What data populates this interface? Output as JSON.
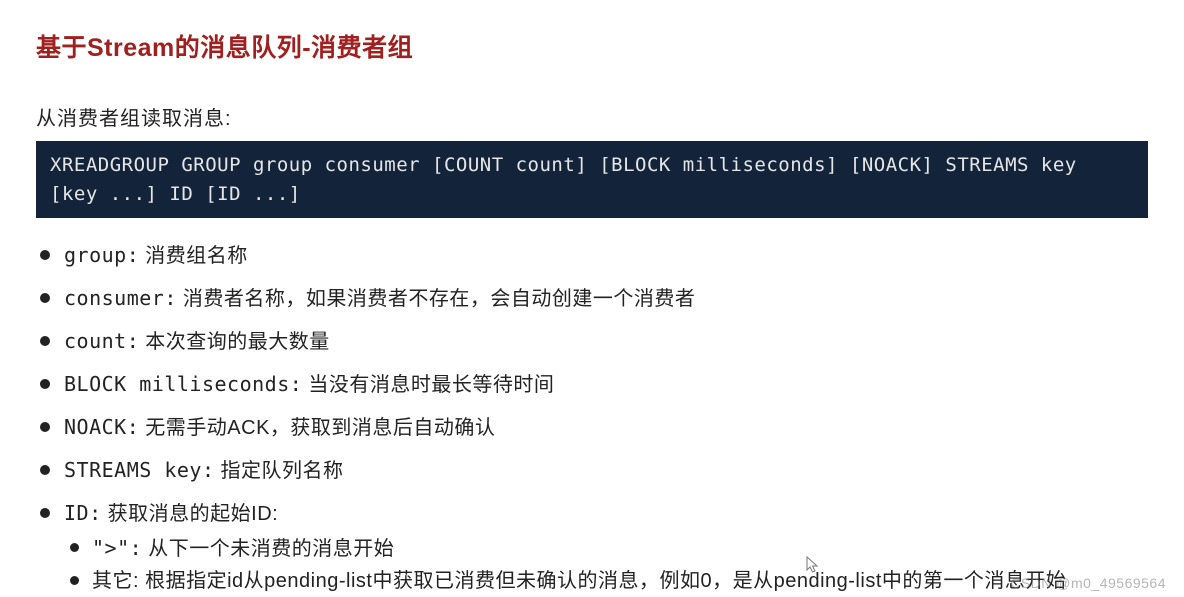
{
  "title": "基于Stream的消息队列-消费者组",
  "subtitle": "从消费者组读取消息:",
  "code": "XREADGROUP GROUP group consumer [COUNT count] [BLOCK milliseconds] [NOACK] STREAMS key [key ...] ID [ID ...]",
  "bullets": [
    {
      "term": "group:",
      "desc": " 消费组名称"
    },
    {
      "term": "consumer:",
      "desc": " 消费者名称，如果消费者不存在，会自动创建一个消费者"
    },
    {
      "term": "count:",
      "desc": " 本次查询的最大数量"
    },
    {
      "term": "BLOCK milliseconds:",
      "desc": " 当没有消息时最长等待时间"
    },
    {
      "term": "NOACK:",
      "desc": " 无需手动ACK，获取到消息后自动确认"
    },
    {
      "term": "STREAMS key:",
      "desc": " 指定队列名称"
    }
  ],
  "id_bullet": {
    "term": "ID:",
    "desc": " 获取消息的起始ID:"
  },
  "id_sub": [
    {
      "term": "\">\":",
      "desc": " 从下一个未消费的消息开始"
    },
    {
      "term": "其它:",
      "desc": " 根据指定id从pending-list中获取已消费但未确认的消息，例如0，是从pending-list中的第一个消息开始"
    }
  ],
  "watermark": "CSDN @m0_49569564"
}
